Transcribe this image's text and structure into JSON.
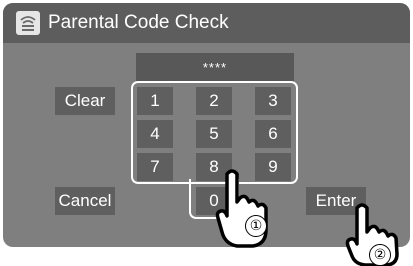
{
  "window": {
    "title": "Parental Code Check",
    "icon": "parental-lock-icon"
  },
  "code_display": {
    "value": "****"
  },
  "side_buttons": {
    "clear": "Clear",
    "cancel": "Cancel",
    "enter": "Enter"
  },
  "keypad": {
    "keys": [
      "1",
      "2",
      "3",
      "4",
      "5",
      "6",
      "7",
      "8",
      "9",
      "0"
    ]
  },
  "callouts": {
    "step1": "①",
    "step2": "②"
  },
  "colors": {
    "screen_bg": "#7f7f7f",
    "titlebar_bg": "#5d5d5d",
    "button_bg": "#5f5f5f",
    "highlight": "#ffffff"
  }
}
